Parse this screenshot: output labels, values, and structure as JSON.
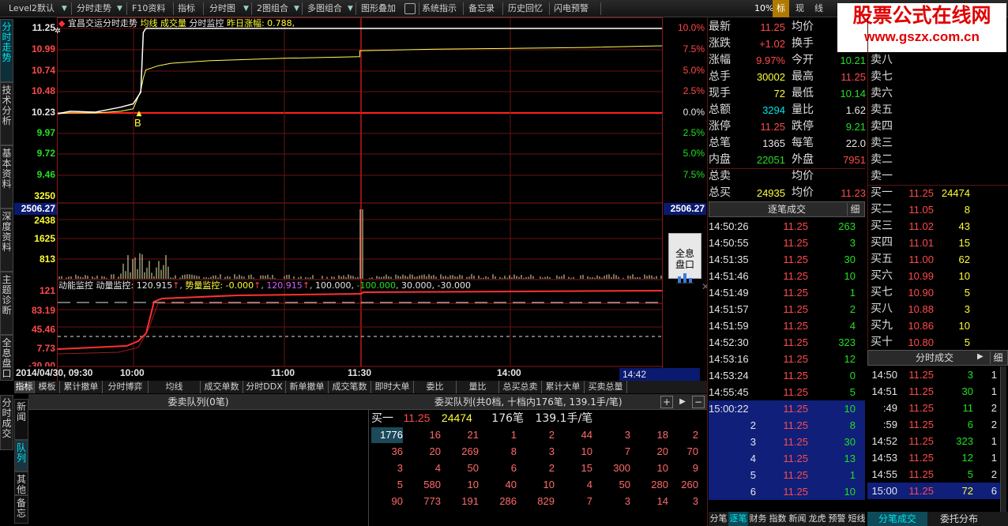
{
  "toolbar": {
    "items": [
      "Level2默认",
      "分时走势",
      "F10资料",
      "指标",
      "分时图",
      "2图组合",
      "多图组合",
      "图形叠加",
      "系统指示",
      "备忘录",
      "历史回忆",
      "闪电预警"
    ],
    "zoom": "10%",
    "btn_biao": "标",
    "btn_xian": "现",
    "btn_xian2": "线"
  },
  "watermark": {
    "title": "股票公式在线网",
    "url": "www.gszx.com.cn"
  },
  "left_tabs": [
    "分时走势",
    "技术分析",
    "基本资料",
    "深度资料",
    "主题诊断",
    "全息盘口"
  ],
  "left_tabs2": [
    "分时成交",
    "新闻",
    "队列",
    "其他",
    "备忘"
  ],
  "chart": {
    "title": "宜昌交运分时走势",
    "link1": "均线",
    "link2": "成交量",
    "link3": "分时监控",
    "prevchg": "昨日涨幅: 0.788,",
    "price_labels": [
      "11.25",
      "10.99",
      "10.74",
      "10.48",
      "10.23",
      "9.97",
      "9.72",
      "9.46"
    ],
    "pct_labels": [
      "10.0%",
      "7.5%",
      "5.0%",
      "2.5%",
      "0.0%",
      "2.5%",
      "5.0%",
      "7.5%"
    ],
    "vol_labels": [
      "3250",
      "2438",
      "1625",
      "813"
    ],
    "index_value": "2506.27",
    "b_marker": "B",
    "ind_title": "动能监控",
    "ind_text1": "动量监控: 120.915",
    "ind_text2": "势量监控: -0.000",
    "ind_v1": "120.915",
    "ind_v2": "100.000,",
    "ind_v3": "-100.000",
    "ind_v4": "30.000,",
    "ind_v5": "-30.000",
    "ind_labels": [
      "121",
      "83.19",
      "45.46",
      "7.73",
      "-30.00"
    ],
    "time_labels": [
      "2014/04/30, 09:30",
      "10:00",
      "11:00",
      "11:30",
      "14:00"
    ],
    "cur_time": "14:42",
    "fullview_btn": "全息\n盘口"
  },
  "chart_data": {
    "type": "line",
    "title": "宜昌交运分时走势",
    "prev_close": 10.23,
    "ylim": [
      9.21,
      11.25
    ],
    "x": [
      "09:30",
      "09:35",
      "09:45",
      "09:50",
      "09:55",
      "10:00",
      "10:03",
      "10:04",
      "10:05",
      "10:10",
      "10:15",
      "10:30",
      "11:00",
      "11:30",
      "13:00",
      "13:30",
      "14:00",
      "14:30",
      "15:00"
    ],
    "series": [
      {
        "values": [
          10.22,
          10.25,
          10.24,
          10.27,
          10.3,
          10.34,
          10.48,
          11.2,
          11.25,
          11.25,
          11.25,
          11.25,
          11.25,
          11.25,
          11.25,
          11.25,
          11.25,
          11.25,
          11.25
        ]
      },
      {
        "values": [
          10.22,
          10.23,
          10.23,
          10.24,
          10.25,
          10.28,
          10.5,
          10.65,
          10.75,
          10.8,
          10.83,
          10.86,
          10.89,
          10.91,
          10.98,
          11.0,
          11.01,
          11.02,
          11.04
        ]
      }
    ]
  },
  "quote": {
    "rows": [
      {
        "k1": "最新",
        "v1": "11.25",
        "c1": "red",
        "k2": "均价",
        "v2": "",
        "c2": "red"
      },
      {
        "k1": "涨跌",
        "v1": "+1.02",
        "c1": "red",
        "k2": "换手",
        "v2": "",
        "c2": "white"
      },
      {
        "k1": "涨幅",
        "v1": "9.97%",
        "c1": "red",
        "k2": "今开",
        "v2": "10.21",
        "c2": "green"
      },
      {
        "k1": "总手",
        "v1": "30002",
        "c1": "yellow",
        "k2": "最高",
        "v2": "11.25",
        "c2": "red"
      },
      {
        "k1": "现手",
        "v1": "72",
        "c1": "yellow",
        "k2": "最低",
        "v2": "10.14",
        "c2": "green"
      },
      {
        "k1": "总额",
        "v1": "3294",
        "c1": "cyan",
        "k2": "量比",
        "v2": "1.62",
        "c2": "white"
      },
      {
        "k1": "涨停",
        "v1": "11.25",
        "c1": "red",
        "k2": "跌停",
        "v2": "9.21",
        "c2": "green"
      },
      {
        "k1": "总笔",
        "v1": "1365",
        "c1": "white",
        "k2": "每笔",
        "v2": "22.0",
        "c2": "white"
      },
      {
        "k1": "内盘",
        "v1": "22051",
        "c1": "green",
        "k2": "外盘",
        "v2": "7951",
        "c2": "red"
      },
      {
        "k1": "总卖",
        "v1": "",
        "c1": "white",
        "k2": "均价",
        "v2": "",
        "c2": "white"
      },
      {
        "k1": "总买",
        "v1": "24935",
        "c1": "yellow",
        "k2": "均价",
        "v2": "11.23",
        "c2": "red"
      }
    ],
    "sells": [
      "卖八",
      "卖七",
      "卖六",
      "卖五",
      "卖四",
      "卖三",
      "卖二",
      "卖一"
    ],
    "buys": [
      {
        "l": "买一",
        "p": "11.25",
        "v": "24474"
      },
      {
        "l": "买二",
        "p": "11.05",
        "v": "8"
      },
      {
        "l": "买三",
        "p": "11.02",
        "v": "43"
      },
      {
        "l": "买四",
        "p": "11.01",
        "v": "15"
      },
      {
        "l": "买五",
        "p": "11.00",
        "v": "62"
      },
      {
        "l": "买六",
        "p": "10.99",
        "v": "10"
      },
      {
        "l": "买七",
        "p": "10.90",
        "v": "5"
      },
      {
        "l": "买八",
        "p": "10.88",
        "v": "3"
      },
      {
        "l": "买九",
        "p": "10.86",
        "v": "10"
      },
      {
        "l": "买十",
        "p": "10.80",
        "v": "5"
      }
    ]
  },
  "ticks": {
    "header": "逐笔成交",
    "tab": "细",
    "rows": [
      {
        "t": "14:50:26",
        "p": "11.25",
        "v": "263"
      },
      {
        "t": "14:50:55",
        "p": "11.25",
        "v": "3"
      },
      {
        "t": "14:51:35",
        "p": "11.25",
        "v": "30"
      },
      {
        "t": "14:51:46",
        "p": "11.25",
        "v": "10"
      },
      {
        "t": "14:51:49",
        "p": "11.25",
        "v": "1"
      },
      {
        "t": "14:51:57",
        "p": "11.25",
        "v": "2"
      },
      {
        "t": "14:51:59",
        "p": "11.25",
        "v": "4"
      },
      {
        "t": "14:52:30",
        "p": "11.25",
        "v": "323"
      },
      {
        "t": "14:53:16",
        "p": "11.25",
        "v": "12"
      },
      {
        "t": "14:53:24",
        "p": "11.25",
        "v": "0"
      },
      {
        "t": "14:55:45",
        "p": "11.25",
        "v": "5"
      },
      {
        "t": "15:00:22",
        "p": "11.25",
        "v": "10"
      },
      {
        "t": "2",
        "p": "11.25",
        "v": "8"
      },
      {
        "t": "3",
        "p": "11.25",
        "v": "30"
      },
      {
        "t": "4",
        "p": "11.25",
        "v": "13"
      },
      {
        "t": "5",
        "p": "11.25",
        "v": "1"
      },
      {
        "t": "6",
        "p": "11.25",
        "v": "10"
      }
    ],
    "bottom_tabs": [
      "分笔",
      "逐笔",
      "财务",
      "指数",
      "新闻",
      "龙虎",
      "预警",
      "短线"
    ]
  },
  "minute_trades": {
    "header": "分时成交",
    "tab": "细",
    "rows": [
      {
        "t": "14:50",
        "p": "11.25",
        "v": "3",
        "n": "1"
      },
      {
        "t": "14:51",
        "p": "11.25",
        "v": "30",
        "n": "1"
      },
      {
        "t": ":49",
        "p": "11.25",
        "v": "11",
        "n": "2"
      },
      {
        "t": ":59",
        "p": "11.25",
        "v": "6",
        "n": "2"
      },
      {
        "t": "14:52",
        "p": "11.25",
        "v": "323",
        "n": "1"
      },
      {
        "t": "14:53",
        "p": "11.25",
        "v": "12",
        "n": "1"
      },
      {
        "t": "14:55",
        "p": "11.25",
        "v": "5",
        "n": "2"
      },
      {
        "t": "15:00",
        "p": "11.25",
        "v": "72",
        "n": "6"
      }
    ],
    "bottom_tabs": [
      "分笔成交",
      "委托分布"
    ]
  },
  "indicator_tabs": [
    "指标",
    "模板",
    "累计撤单",
    "分时博弈",
    "均线",
    "成交单数",
    "分时DDX",
    "新单撤单",
    "成交笔数",
    "即时大单",
    "委比",
    "量比",
    "总买总卖",
    "累计大单",
    "买卖总量"
  ],
  "queue": {
    "sell_title": "委卖队列(0笔)",
    "buy_title": "委买队列(共0档, 十档内176笔, 139.1手/笔)",
    "buy1_label": "买一",
    "buy1_price": "11.25",
    "buy1_vol": "24474",
    "buy1_count": "176笔",
    "buy1_avg": "139.1手/笔",
    "cells": [
      [
        "1776",
        "16",
        "21",
        "1",
        "2",
        "44",
        "3",
        "18",
        "2"
      ],
      [
        "36",
        "20",
        "269",
        "8",
        "3",
        "10",
        "7",
        "20",
        "70"
      ],
      [
        "3",
        "4",
        "50",
        "6",
        "2",
        "15",
        "300",
        "10",
        "9"
      ],
      [
        "5",
        "580",
        "10",
        "40",
        "10",
        "4",
        "50",
        "280",
        "260"
      ],
      [
        "90",
        "773",
        "191",
        "286",
        "829",
        "7",
        "3",
        "14",
        "3"
      ]
    ]
  }
}
